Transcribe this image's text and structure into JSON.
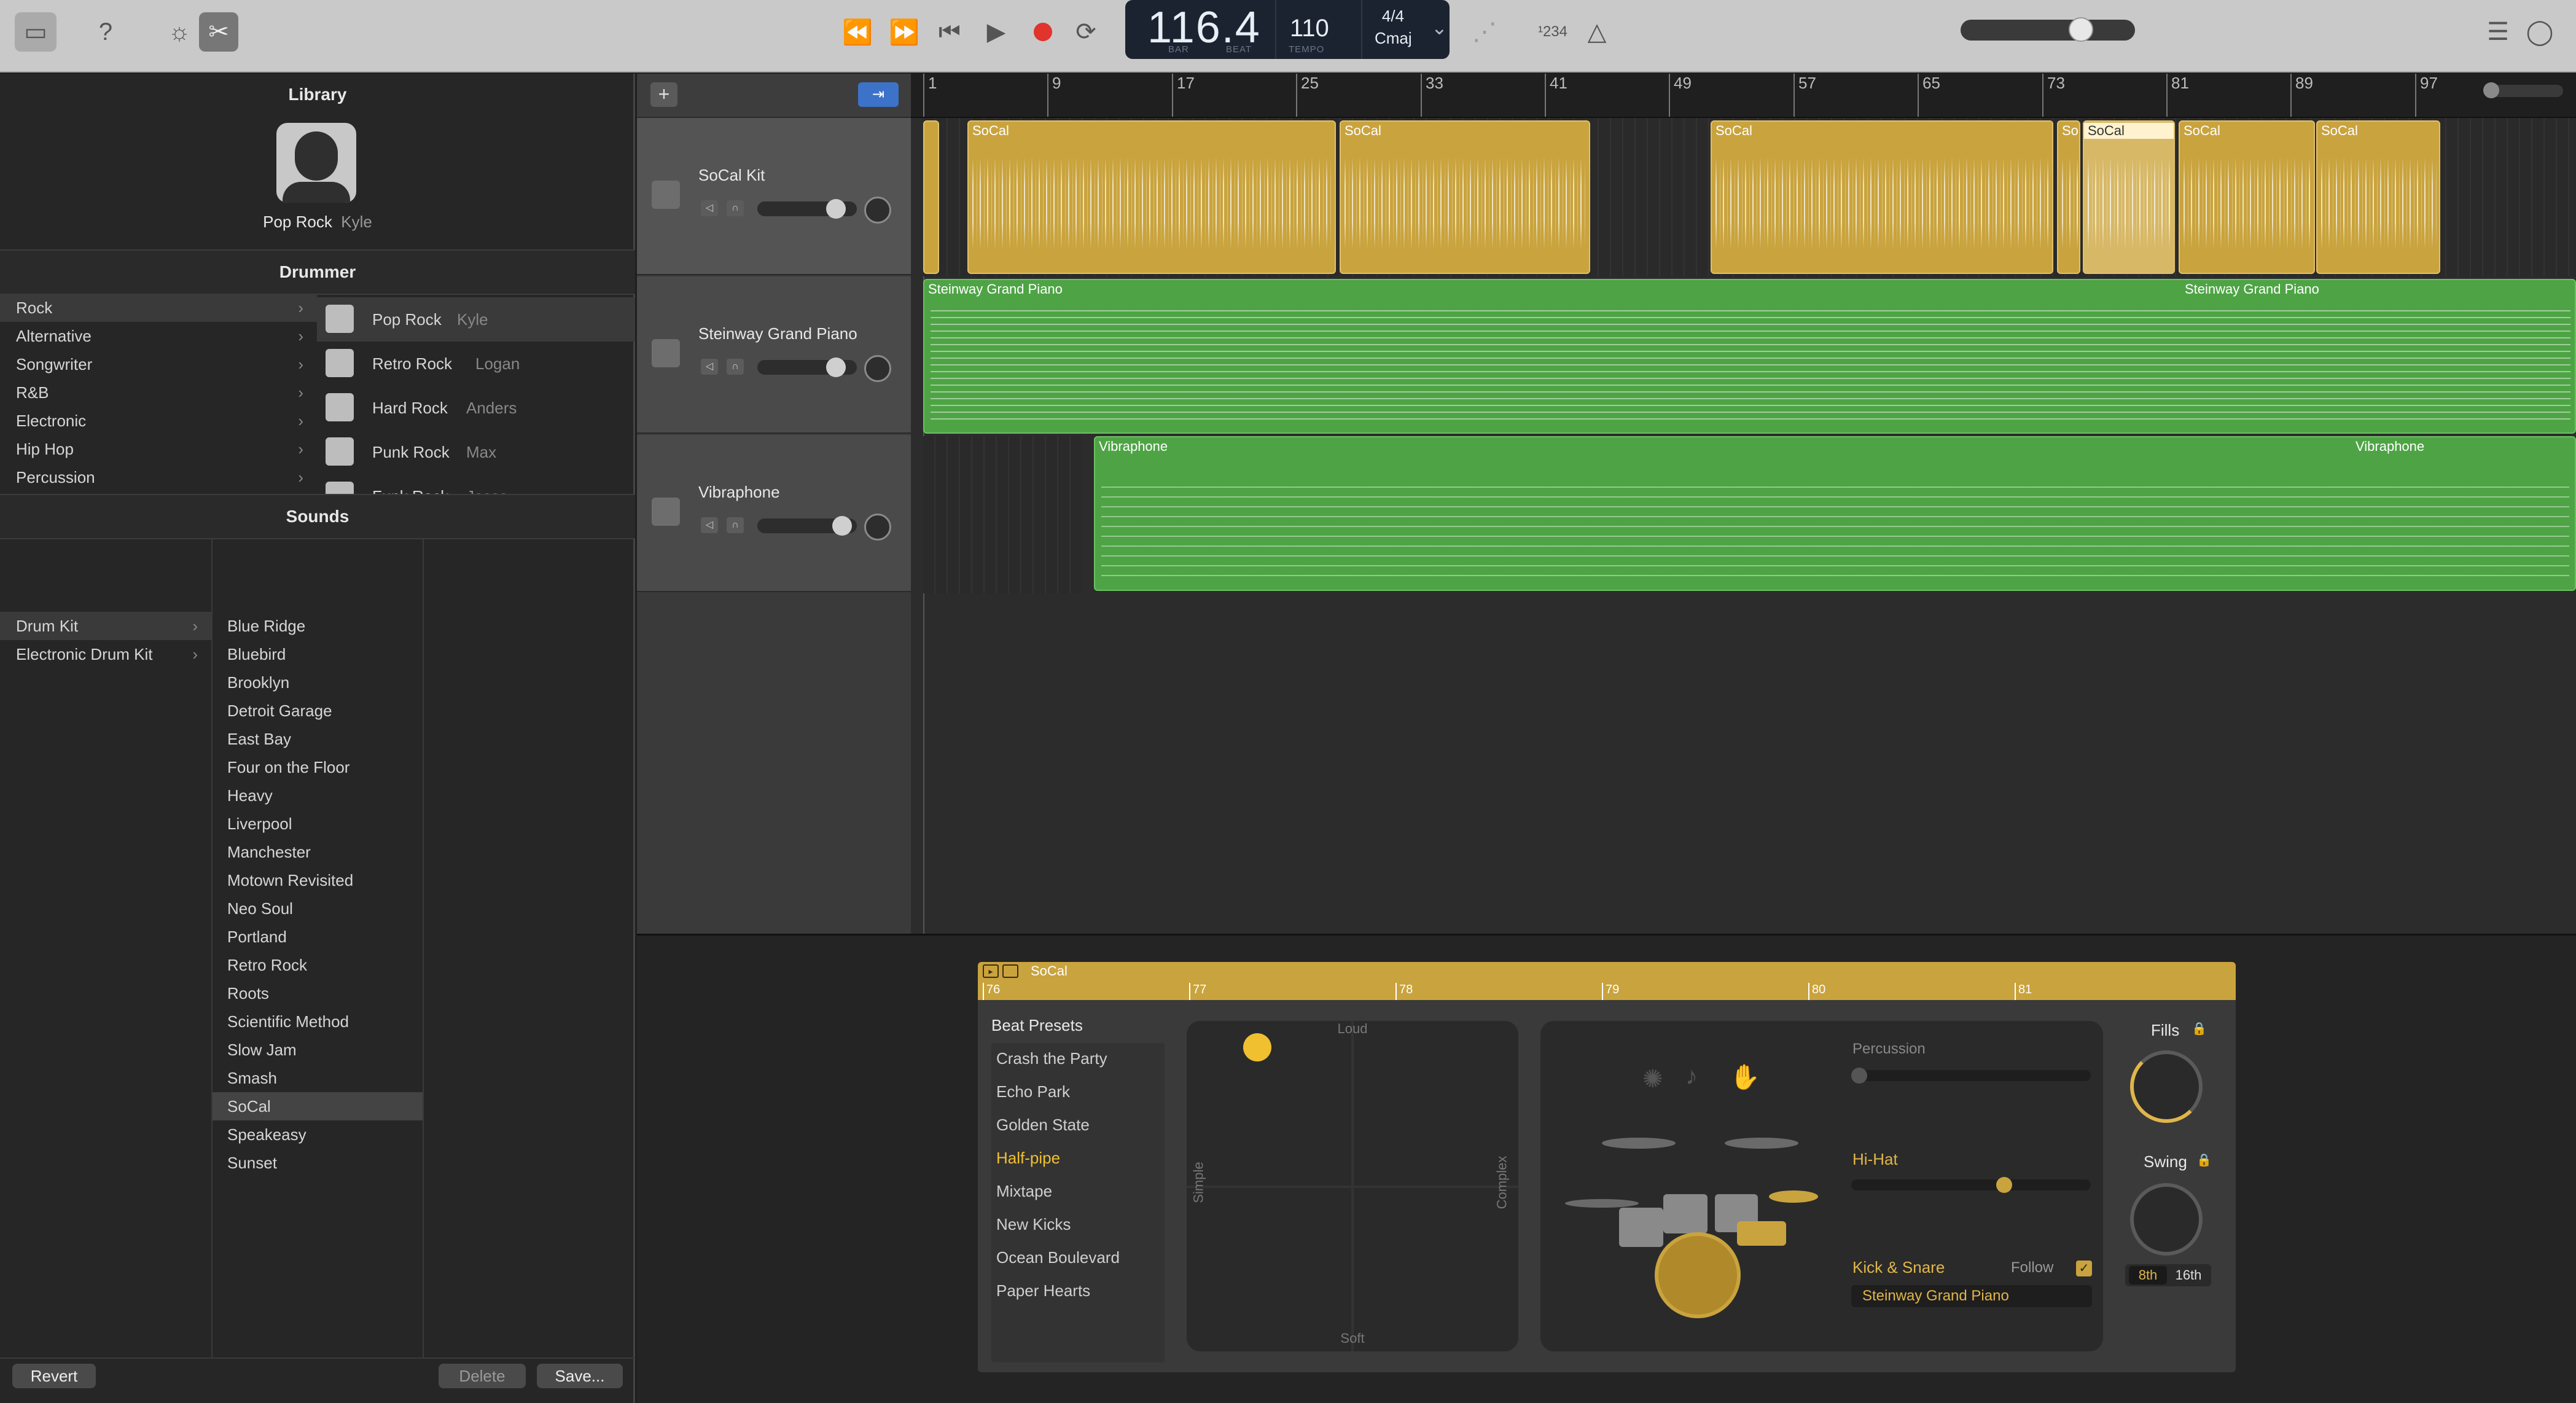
{
  "toolbar": {
    "position": "116.4",
    "bar_label": "BAR",
    "beat_label": "BEAT",
    "tempo": "110",
    "tempo_label": "TEMPO",
    "signature": "4/4",
    "key": "Cmaj",
    "count_in": "¹234"
  },
  "library": {
    "title": "Library",
    "drummer_name": "Pop Rock",
    "drummer_person": "Kyle",
    "drummer_header": "Drummer",
    "genres": [
      {
        "label": "Rock"
      },
      {
        "label": "Alternative"
      },
      {
        "label": "Songwriter"
      },
      {
        "label": "R&B"
      },
      {
        "label": "Electronic"
      },
      {
        "label": "Hip Hop"
      },
      {
        "label": "Percussion"
      }
    ],
    "drummers": [
      {
        "style": "Pop Rock",
        "name": "Kyle"
      },
      {
        "style": "Retro Rock",
        "name": "Logan"
      },
      {
        "style": "Hard Rock",
        "name": "Anders"
      },
      {
        "style": "Punk Rock",
        "name": "Max"
      },
      {
        "style": "Funk Rock",
        "name": "Jesse"
      }
    ],
    "sounds_header": "Sounds",
    "categories": [
      {
        "label": "Drum Kit"
      },
      {
        "label": "Electronic Drum Kit"
      }
    ],
    "kits": [
      "Blue Ridge",
      "Bluebird",
      "Brooklyn",
      "Detroit Garage",
      "East Bay",
      "Four on the Floor",
      "Heavy",
      "Liverpool",
      "Manchester",
      "Motown Revisited",
      "Neo Soul",
      "Portland",
      "Retro Rock",
      "Roots",
      "Scientific Method",
      "Slow Jam",
      "Smash",
      "SoCal",
      "Speakeasy",
      "Sunset"
    ],
    "revert": "Revert",
    "delete": "Delete",
    "save": "Save..."
  },
  "tracks": [
    {
      "name": "SoCal Kit"
    },
    {
      "name": "Steinway Grand Piano"
    },
    {
      "name": "Vibraphone"
    }
  ],
  "ruler": [
    "1",
    "9",
    "17",
    "25",
    "33",
    "41",
    "49",
    "57",
    "65",
    "73",
    "81",
    "89",
    "97"
  ],
  "regions": {
    "drum": "SoCal",
    "piano": "Steinway Grand Piano",
    "vibes": "Vibraphone",
    "drum_short": "So"
  },
  "editor": {
    "region_name": "SoCal",
    "bars": [
      "76",
      "77",
      "78",
      "79",
      "80",
      "81"
    ],
    "presets_title": "Beat Presets",
    "presets": [
      "Crash the Party",
      "Echo Park",
      "Golden State",
      "Half-pipe",
      "Mixtape",
      "New Kicks",
      "Ocean Boulevard",
      "Paper Hearts"
    ],
    "loud": "Loud",
    "soft": "Soft",
    "simple": "Simple",
    "complex": "Complex",
    "percussion": "Percussion",
    "hihat": "Hi-Hat",
    "kick_snare": "Kick & Snare",
    "follow": "Follow",
    "follow_track": "Steinway Grand Piano",
    "fills": "Fills",
    "swing": "Swing",
    "eighth": "8th",
    "sixteenth": "16th"
  },
  "colors": {
    "drum": "#c9a33d",
    "midi": "#4ea445",
    "accent": "#f0c030",
    "record": "#e0342c"
  }
}
